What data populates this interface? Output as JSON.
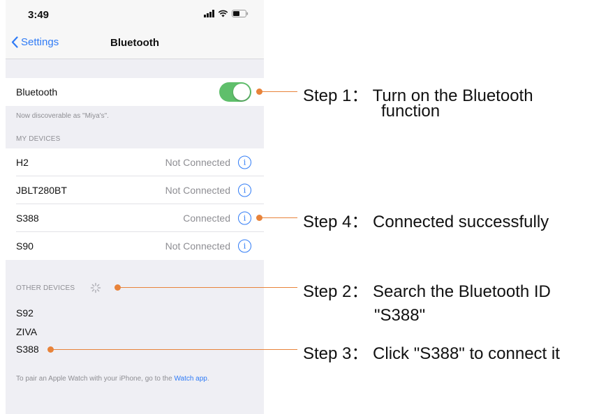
{
  "status_bar": {
    "time": "3:49"
  },
  "nav": {
    "back_label": "Settings",
    "title": "Bluetooth"
  },
  "bluetooth_row": {
    "label": "Bluetooth",
    "toggle_on": true
  },
  "discoverable_text": "Now discoverable as \"Miya's\".",
  "my_devices": {
    "header": "MY DEVICES",
    "items": [
      {
        "name": "H2",
        "status": "Not Connected"
      },
      {
        "name": "JBLT280BT",
        "status": "Not Connected"
      },
      {
        "name": "S388",
        "status": "Connected"
      },
      {
        "name": "S90",
        "status": "Not Connected"
      }
    ]
  },
  "other_devices": {
    "header": "OTHER DEVICES",
    "items": [
      {
        "name": "S92"
      },
      {
        "name": "ZIVA"
      },
      {
        "name": "S388"
      }
    ]
  },
  "footer": {
    "text": "To pair an Apple Watch with your iPhone, go to the ",
    "link": "Watch app",
    "end": "."
  },
  "annotations": {
    "step1_a": "Step 1： Turn on the Bluetooth",
    "step1_b": "function",
    "step4": "Step 4： Connected successfully",
    "step2_a": "Step 2： Search the Bluetooth ID",
    "step2_b": "\"S388\"",
    "step3": "Step 3： Click \"S388\" to connect it"
  },
  "colors": {
    "accent": "#2f7bf6",
    "toggle": "#5fbf6b",
    "annotation": "#e8833a"
  }
}
